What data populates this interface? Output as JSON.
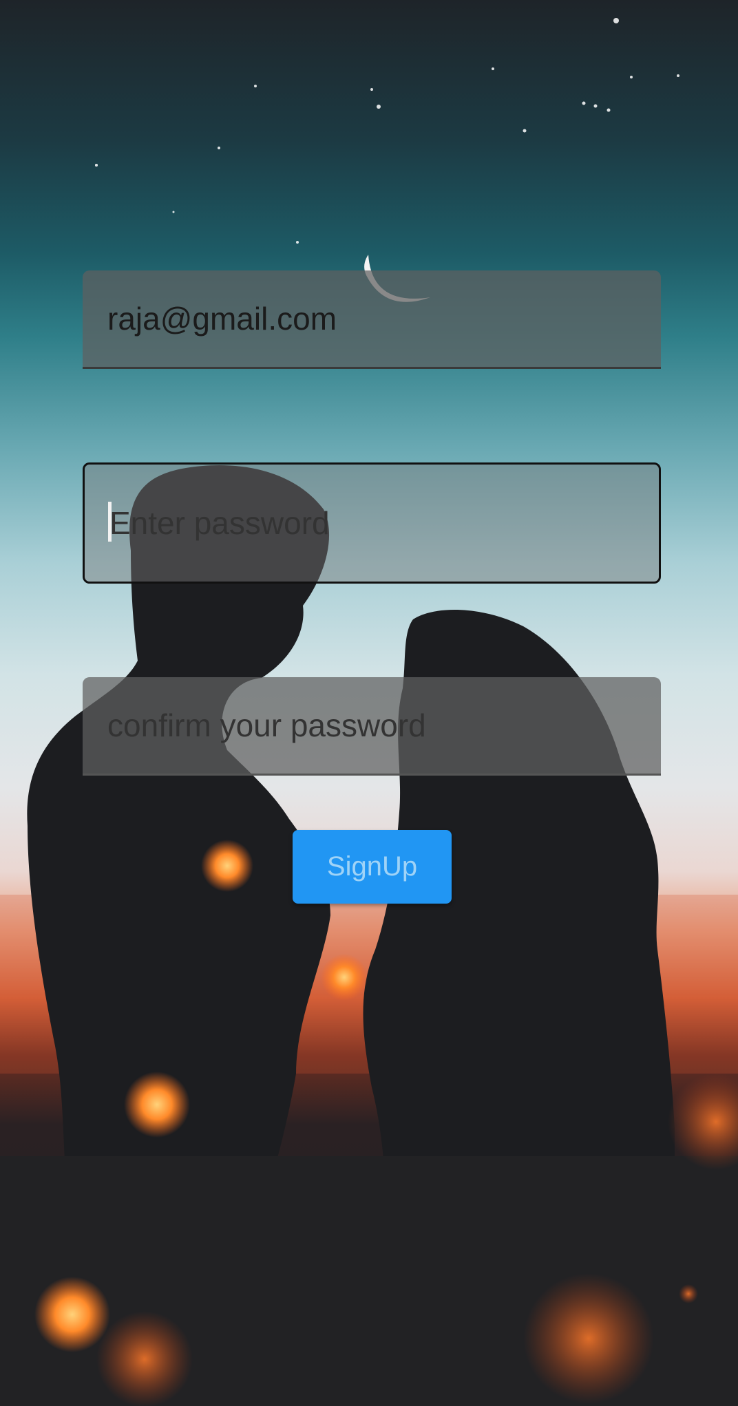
{
  "form": {
    "email_value": "raja@gmail.com",
    "password_placeholder": "Enter password",
    "confirm_placeholder": "confirm your password",
    "signup_label": "SignUp"
  },
  "colors": {
    "button": "#2196f3",
    "button_text": "#9fd3f7",
    "field_fill": "#5f5f5f",
    "focused_border": "#111111"
  }
}
